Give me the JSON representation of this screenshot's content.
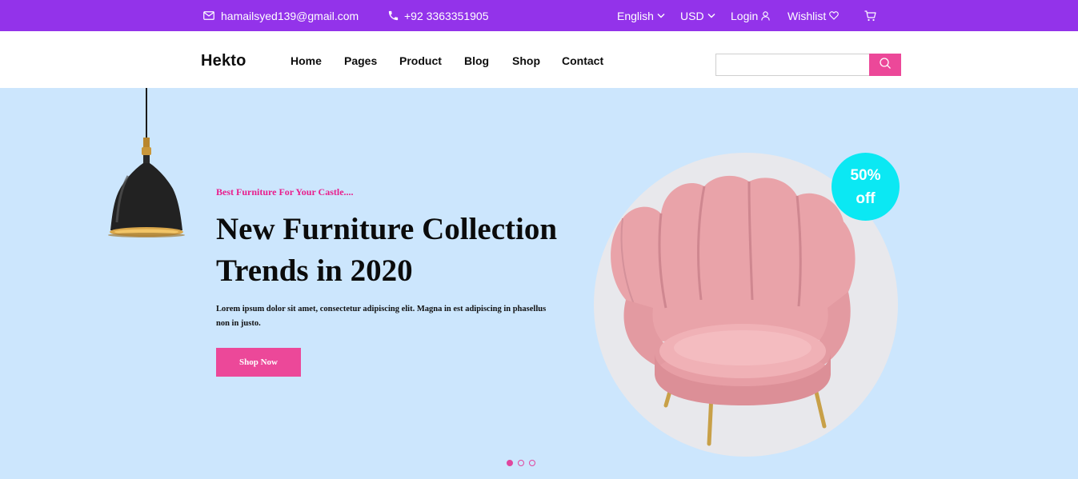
{
  "topbar": {
    "email": "hamailsyed139@gmail.com",
    "phone": "+92 3363351905",
    "language": "English",
    "currency": "USD",
    "login": "Login",
    "wishlist": "Wishlist",
    "icons": [
      "mail-icon",
      "phone-icon",
      "chevron-down-icon",
      "user-icon",
      "heart-icon",
      "cart-icon"
    ]
  },
  "header": {
    "logo": "Hekto",
    "nav": [
      {
        "label": "Home"
      },
      {
        "label": "Pages"
      },
      {
        "label": "Product"
      },
      {
        "label": "Blog"
      },
      {
        "label": "Shop"
      },
      {
        "label": "Contact"
      }
    ],
    "search": {
      "placeholder": "",
      "value": ""
    }
  },
  "hero": {
    "tagline": "Best Furniture For Your Castle....",
    "title_line1": "New Furniture Collection",
    "title_line2": "Trends in 2020",
    "description": "Lorem ipsum dolor sit amet, consectetur adipiscing elit. Magna in est adipiscing in phasellus non in justo.",
    "cta_label": "Shop Now",
    "badge_line1": "50%",
    "badge_line2": "off",
    "slides": [
      {
        "active": true
      },
      {
        "active": false
      },
      {
        "active": false
      }
    ]
  },
  "colors": {
    "topbar": "#9333ea",
    "accent": "#ec4899",
    "hero_bg": "#cce6fd",
    "badge": "#0be8f3"
  }
}
